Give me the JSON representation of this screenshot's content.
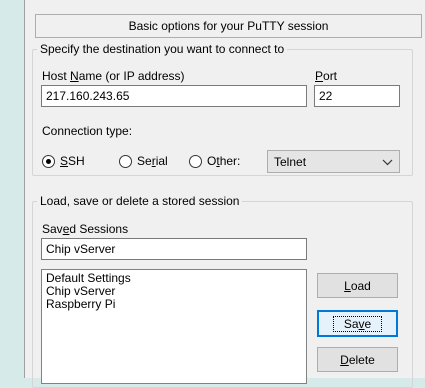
{
  "header": {
    "title": "Basic options for your PuTTY session"
  },
  "destination": {
    "legend": "Specify the destination you want to connect to",
    "host_label_pre": "Host ",
    "host_label_ul": "N",
    "host_label_post": "ame (or IP address)",
    "host_value": "217.160.243.65",
    "port_label_ul": "P",
    "port_label_post": "ort",
    "port_value": "22",
    "conn_type_label": "Connection type:",
    "ssh_ul": "S",
    "ssh_post": "SH",
    "serial_pre": "Se",
    "serial_ul": "r",
    "serial_post": "ial",
    "other_pre": "O",
    "other_ul": "t",
    "other_post": "her:",
    "other_select_value": "Telnet",
    "selected_connection": "SSH"
  },
  "sessions": {
    "legend": "Load, save or delete a stored session",
    "saved_label_pre": "Sav",
    "saved_label_ul": "e",
    "saved_label_post": "d Sessions",
    "saved_value": "Chip vServer",
    "items": [
      "Default Settings",
      "Chip vServer",
      "Raspberry Pi"
    ],
    "load_ul": "L",
    "load_post": "oad",
    "save_pre": "Sa",
    "save_ul": "v",
    "save_post": "e",
    "delete_ul": "D",
    "delete_post": "elete"
  },
  "icons": {
    "dropdown": "chevron-down-icon"
  }
}
